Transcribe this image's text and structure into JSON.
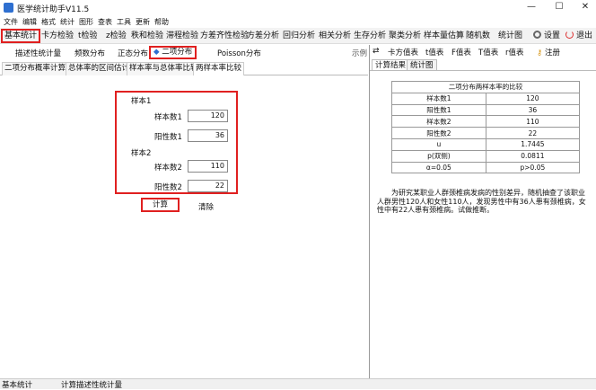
{
  "app": {
    "title": "医学统计助手V11.5"
  },
  "window": {
    "minimize": "—",
    "maximize": "☐",
    "close": "✕"
  },
  "menu": [
    "文件",
    "编辑",
    "格式",
    "统计",
    "图形",
    "查表",
    "工具",
    "更新",
    "帮助"
  ],
  "toolbar": {
    "items": [
      "基本统计",
      "卡方检验",
      "t检验",
      "z检验",
      "秩和检验",
      "滞程检验",
      "方差齐性检验",
      "方差分析",
      "回归分析",
      "相关分析",
      "生存分析",
      "聚类分析",
      "样本量估算",
      "随机数",
      "统计图"
    ],
    "settings": "设置",
    "logout": "退出"
  },
  "subtabs": {
    "items": [
      "描述性统计量",
      "频数分布",
      "正态分布",
      "二项分布",
      "Poisson分布"
    ],
    "right_label": "示例"
  },
  "tabs3": [
    "二项分布概率计算",
    "总体率的区间估计",
    "样本率与总体率比较",
    "两样本率比较"
  ],
  "form": {
    "group1_label": "样本1",
    "group2_label": "样本2",
    "n1_label": "样本数1",
    "pos1_label": "阳性数1",
    "n2_label": "样本数2",
    "pos2_label": "阳性数2",
    "n1": "120",
    "pos1": "36",
    "n2": "110",
    "pos2": "22",
    "calc_button": "计算",
    "clear_button": "清除"
  },
  "right_toolbar": {
    "swap_icon": "⇄",
    "items": [
      "卡方值表",
      "t值表",
      "F值表",
      "T值表",
      "r值表"
    ],
    "register": "注册"
  },
  "right_tabs": [
    "计算结果",
    "统计图"
  ],
  "result_table": {
    "title": "二项分布两样本率的比较",
    "rows": [
      {
        "label": "样本数1",
        "value": "120"
      },
      {
        "label": "阳性数1",
        "value": "36"
      },
      {
        "label": "样本数2",
        "value": "110"
      },
      {
        "label": "阳性数2",
        "value": "22"
      },
      {
        "label": "u",
        "value": "1.7445"
      },
      {
        "label": "p(双侧)",
        "value": "0.0811"
      },
      {
        "label": "α=0.05",
        "value": "p>0.05"
      }
    ]
  },
  "note": "为研究某职业人群颈椎病发病的性别差异，随机抽查了该职业人群男性120人和女性110人，发现男性中有36人患有颈椎病，女性中有22人患有颈椎病。试做推断。",
  "status": {
    "left": "基本统计",
    "right": "计算描述性统计量"
  },
  "colors": {
    "highlight_border": "#e02020",
    "accent": "#2e6fd0"
  }
}
